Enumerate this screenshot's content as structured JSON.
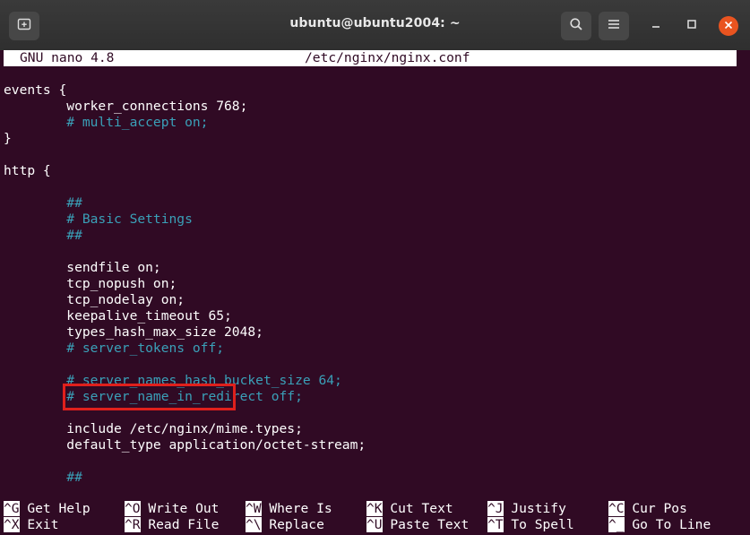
{
  "window": {
    "title": "ubuntu@ubuntu2004: ~"
  },
  "titlebar_icons": {
    "new_tab": "new-tab-icon",
    "search": "search-icon",
    "menu": "hamburger-menu-icon",
    "minimize": "minimize-icon",
    "maximize": "maximize-icon",
    "close": "close-icon"
  },
  "colors": {
    "terminal_bg": "#300a24",
    "comment": "#3aa0b8",
    "highlight": "#e0201c",
    "close_button": "#e95420"
  },
  "nano": {
    "version": "GNU nano 4.8",
    "filename": "/etc/nginx/nginx.conf"
  },
  "lines": [
    {
      "text": "events {",
      "comment": false
    },
    {
      "text": "        worker_connections 768;",
      "comment": false
    },
    {
      "text": "        # multi_accept on;",
      "comment": true
    },
    {
      "text": "}",
      "comment": false
    },
    {
      "text": "",
      "comment": false
    },
    {
      "text": "http {",
      "comment": false
    },
    {
      "text": "",
      "comment": false
    },
    {
      "text": "        ##",
      "comment": true
    },
    {
      "text": "        # Basic Settings",
      "comment": true
    },
    {
      "text": "        ##",
      "comment": true
    },
    {
      "text": "",
      "comment": false
    },
    {
      "text": "        sendfile on;",
      "comment": false
    },
    {
      "text": "        tcp_nopush on;",
      "comment": false
    },
    {
      "text": "        tcp_nodelay on;",
      "comment": false
    },
    {
      "text": "        keepalive_timeout 65;",
      "comment": false
    },
    {
      "text": "        types_hash_max_size 2048;",
      "comment": false
    },
    {
      "text": "        # server_tokens off;",
      "comment": true
    },
    {
      "text": "",
      "comment": false
    },
    {
      "text": "        # server_names_hash_bucket_size 64;",
      "comment": true
    },
    {
      "text": "        # server_name_in_redirect off;",
      "comment": true
    },
    {
      "text": "",
      "comment": false
    },
    {
      "text": "        include /etc/nginx/mime.types;",
      "comment": false
    },
    {
      "text": "        default_type application/octet-stream;",
      "comment": false
    },
    {
      "text": "",
      "comment": false
    },
    {
      "text": "        ##",
      "comment": true
    }
  ],
  "shortcuts": [
    [
      {
        "key": "^G",
        "label": " Get Help"
      },
      {
        "key": "^O",
        "label": " Write Out"
      },
      {
        "key": "^W",
        "label": " Where Is"
      },
      {
        "key": "^K",
        "label": " Cut Text"
      },
      {
        "key": "^J",
        "label": " Justify"
      },
      {
        "key": "^C",
        "label": " Cur Pos"
      }
    ],
    [
      {
        "key": "^X",
        "label": " Exit"
      },
      {
        "key": "^R",
        "label": " Read File"
      },
      {
        "key": "^\\",
        "label": " Replace"
      },
      {
        "key": "^U",
        "label": " Paste Text"
      },
      {
        "key": "^T",
        "label": " To Spell"
      },
      {
        "key": "^_",
        "label": " Go To Line"
      }
    ]
  ]
}
